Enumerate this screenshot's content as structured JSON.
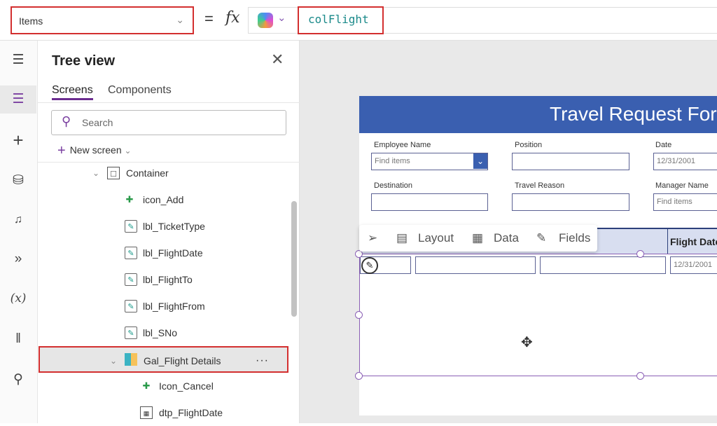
{
  "formula_bar": {
    "property": "Items",
    "equals": "=",
    "fx": "fx",
    "formula": "colFlight"
  },
  "rail": {
    "icons": [
      "hamburger-icon",
      "layers-icon",
      "plus-icon",
      "database-icon",
      "media-icon",
      "power-automate-icon",
      "variables-icon",
      "tools-icon",
      "search-icon"
    ],
    "variables_label": "(x)"
  },
  "tree": {
    "title": "Tree view",
    "tabs": [
      "Screens",
      "Components"
    ],
    "search_placeholder": "Search",
    "new_screen": "New screen",
    "nodes": [
      {
        "label": "Container",
        "type": "container",
        "expanded": true
      },
      {
        "label": "icon_Add",
        "type": "icon"
      },
      {
        "label": "lbl_TicketType",
        "type": "label"
      },
      {
        "label": "lbl_FlightDate",
        "type": "label"
      },
      {
        "label": "lbl_FlightTo",
        "type": "label"
      },
      {
        "label": "lbl_FlightFrom",
        "type": "label"
      },
      {
        "label": "lbl_SNo",
        "type": "label"
      },
      {
        "label": "Gal_Flight Details",
        "type": "gallery",
        "expanded": true,
        "selected": true
      },
      {
        "label": "Icon_Cancel",
        "type": "icon"
      },
      {
        "label": "dtp_FlightDate",
        "type": "datepicker"
      }
    ]
  },
  "form": {
    "title": "Travel Request For",
    "fields": {
      "employee_name": {
        "label": "Employee Name",
        "placeholder": "Find items"
      },
      "position": {
        "label": "Position"
      },
      "date": {
        "label": "Date",
        "value": "12/31/2001"
      },
      "destination": {
        "label": "Destination"
      },
      "travel_reason": {
        "label": "Travel Reason"
      },
      "manager_name": {
        "label": "Manager Name",
        "placeholder": "Find items"
      }
    },
    "gallery_header_flight_date": "Flight Date",
    "row_date": "12/31/2001"
  },
  "context_toolbar": {
    "layout": "Layout",
    "data": "Data",
    "fields": "Fields"
  },
  "colors": {
    "header_blue": "#3a5fb0",
    "accent_purple": "#6b2c8f",
    "highlight_red": "#d32f2f"
  }
}
